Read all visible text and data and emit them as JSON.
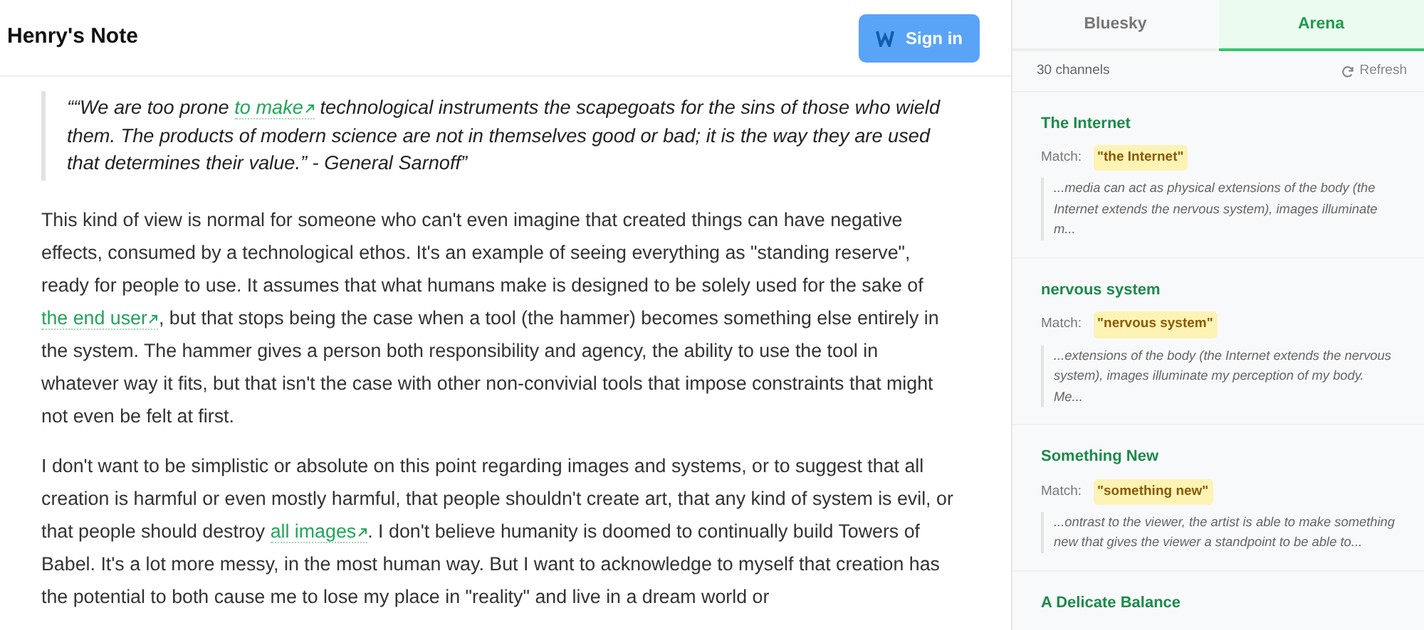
{
  "header": {
    "title": "Henry's Note",
    "sign_in": "Sign in"
  },
  "article": {
    "quote": [
      {
        "kind": "text",
        "text": "““We are too prone "
      },
      {
        "kind": "link",
        "text": "to make"
      },
      {
        "kind": "text",
        "text": " technological instruments the scapegoats for the sins of those who wield them. The products of modern science are not in themselves good or bad; it is the way they are used that determines their value.” - General Sarnoff”"
      }
    ],
    "paragraphs": [
      [
        {
          "kind": "text",
          "text": "This kind of view is normal for someone who can't even imagine that created things can have negative effects, consumed by a technological ethos. It's an example of seeing everything as \"standing reserve\", ready for people to use. It assumes that what humans make is designed to be solely used for the sake of "
        },
        {
          "kind": "link",
          "text": "the end user"
        },
        {
          "kind": "text",
          "text": ", but that stops being the case when a tool (the hammer) becomes something else entirely in the system. The hammer gives a person both responsibility and agency, the ability to use the tool in whatever way it fits, but that isn't the case with other non-convivial tools that impose constraints that might not even be felt at first."
        }
      ],
      [
        {
          "kind": "text",
          "text": "I don't want to be simplistic or absolute on this point regarding images and systems, or to suggest that all creation is harmful or even mostly harmful, that people shouldn't create art, that any kind of system is evil, or that people should destroy "
        },
        {
          "kind": "link",
          "text": "all images"
        },
        {
          "kind": "text",
          "text": ". I don't believe humanity is doomed to continually build Towers of Babel. It's a lot more messy, in the most human way. But I want to acknowledge to myself that creation has the potential to both cause me to lose my place in \"reality\" and live in a dream world or"
        }
      ]
    ]
  },
  "sidebar": {
    "tabs": [
      {
        "label": "Bluesky",
        "selected": false
      },
      {
        "label": "Arena",
        "selected": true
      }
    ],
    "count": "30 channels",
    "refresh": "Refresh",
    "channels": [
      {
        "title": "The Internet",
        "match_label": "Match:",
        "match": "\"the Internet\"",
        "excerpt": "...media can act as physical extensions of the body (the Internet extends the nervous system), images illuminate m..."
      },
      {
        "title": "nervous system",
        "match_label": "Match:",
        "match": "\"nervous system\"",
        "excerpt": "...extensions of the body (the Internet extends the nervous system), images illuminate my perception of my body. Me..."
      },
      {
        "title": "Something New",
        "match_label": "Match:",
        "match": "\"something new\"",
        "excerpt": "...ontrast to the viewer, the artist is able to make something new that gives the viewer a standpoint to be able to..."
      },
      {
        "title": "A Delicate Balance"
      }
    ]
  }
}
